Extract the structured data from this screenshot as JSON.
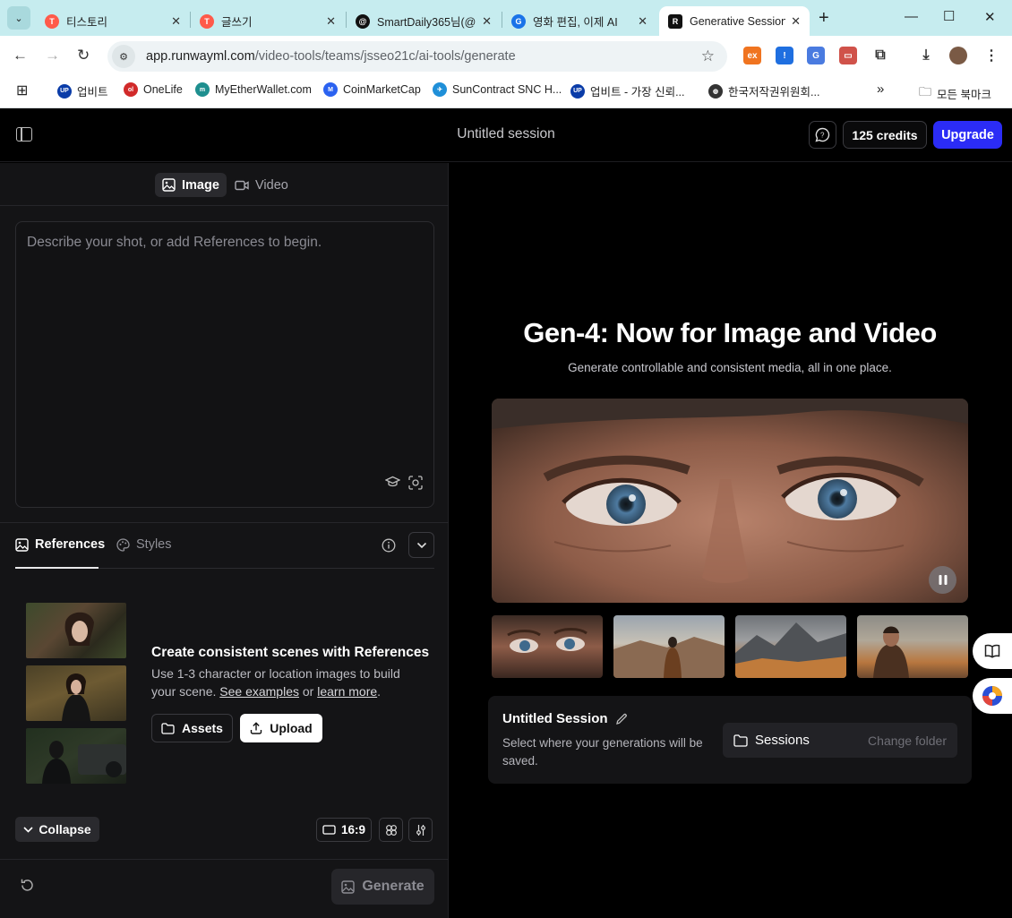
{
  "browser": {
    "tabs": [
      {
        "title": "티스토리",
        "icon_color": "#ff5a4a"
      },
      {
        "title": "글쓰기",
        "icon_color": "#ff5a4a"
      },
      {
        "title": "SmartDaily365님(@",
        "icon_color": "#111111"
      },
      {
        "title": "영화 편집, 이제 AI",
        "icon_color": "#1a73e8"
      },
      {
        "title": "Generative Session",
        "icon_color": "#111111"
      }
    ],
    "url_domain": "app.runwayml.com",
    "url_path": "/video-tools/teams/jsseo21c/ai-tools/generate",
    "bookmarks": [
      {
        "label": "업비트",
        "icon": "UP",
        "color": "#0a3ca8"
      },
      {
        "label": "OneLife",
        "icon": "ol",
        "color": "#d12a2a"
      },
      {
        "label": "MyEtherWallet.com",
        "icon": "mew",
        "color": "#1e8f8f"
      },
      {
        "label": "CoinMarketCap",
        "icon": "M",
        "color": "#2b62f0"
      },
      {
        "label": "SunContract SNC H...",
        "icon": "sc",
        "color": "#1f8fd8"
      },
      {
        "label": "업비트 - 가장 신뢰...",
        "icon": "UP",
        "color": "#0a3ca8"
      },
      {
        "label": "한국저작권위원회...",
        "icon": "globe",
        "color": "#333333"
      }
    ],
    "all_bookmarks_label": "모든 북마크",
    "extensions": [
      {
        "icon": "ex",
        "color": "#f07420"
      },
      {
        "icon": "shield",
        "color": "#1f6fe0"
      },
      {
        "icon": "translate",
        "color": "#4a7be0"
      },
      {
        "icon": "cast",
        "color": "#d0524a"
      }
    ]
  },
  "app": {
    "session_title": "Untitled session",
    "credits_label": "125 credits",
    "upgrade_label": "Upgrade",
    "mode_tabs": [
      {
        "label": "Image",
        "icon": "image-icon",
        "active": true
      },
      {
        "label": "Video",
        "icon": "video-icon",
        "active": false
      }
    ],
    "prompt_placeholder": "Describe your shot, or add References to begin.",
    "ref_tabs": [
      {
        "label": "References",
        "active": true
      },
      {
        "label": "Styles",
        "active": false
      }
    ],
    "references": {
      "title": "Create consistent scenes with References",
      "desc_prefix": "Use 1-3 character or location images to build your scene. ",
      "see_examples": "See examples",
      "or_text": " or ",
      "learn_more": "learn more",
      "period": ".",
      "assets_label": "Assets",
      "upload_label": "Upload"
    },
    "collapse_label": "Collapse",
    "ratio_label": "16:9",
    "generate_label": "Generate",
    "hero": {
      "title": "Gen-4: Now for Image and Video",
      "subtitle": "Generate controllable and consistent media, all in one place."
    },
    "session_card": {
      "title": "Untitled Session",
      "desc": "Select where your generations will be saved.",
      "folder_name": "Sessions",
      "change_folder": "Change folder"
    }
  }
}
